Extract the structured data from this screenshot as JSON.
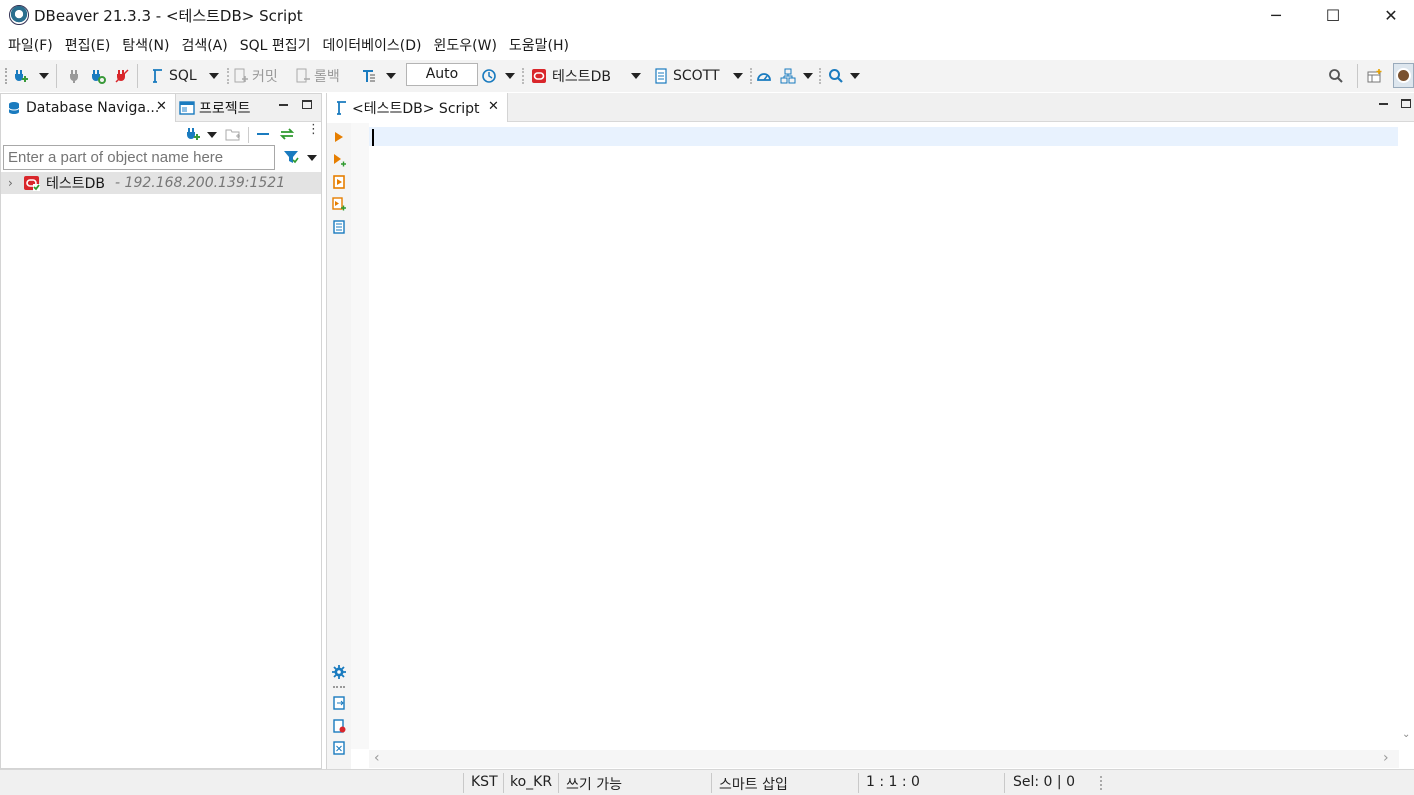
{
  "window": {
    "title": "DBeaver 21.3.3 - <테스트DB> Script",
    "minimize_label": "─",
    "maximize_label": "☐",
    "close_label": "✕"
  },
  "menubar": {
    "items": [
      "파일(F)",
      "편집(E)",
      "탐색(N)",
      "검색(A)",
      "SQL 편집기",
      "데이터베이스(D)",
      "윈도우(W)",
      "도움말(H)"
    ]
  },
  "toolbar": {
    "sql_label": "SQL",
    "commit_label": "커밋",
    "rollback_label": "롤백",
    "transaction_mode": "Auto",
    "datasource_label": "테스트DB",
    "schema_label": "SCOTT"
  },
  "navigator": {
    "tab_label": "Database Naviga...",
    "projects_tab_label": "프로젝트",
    "filter_placeholder": "Enter a part of object name here",
    "connection_name": "테스트DB",
    "connection_address": "- 192.168.200.139:1521"
  },
  "editor": {
    "tab_label": "<테스트DB> Script",
    "content": ""
  },
  "statusbar": {
    "timezone": "KST",
    "locale": "ko_KR",
    "write_mode": "쓰기 가능",
    "insert_mode": "스마트 삽입",
    "position": "1 : 1 : 0",
    "selection": "Sel: 0 | 0"
  },
  "colors": {
    "accent_blue": "#1a7bbf",
    "oracle_red": "#d9262b",
    "run_orange": "#e67e00",
    "current_line": "#e8f2fe"
  }
}
